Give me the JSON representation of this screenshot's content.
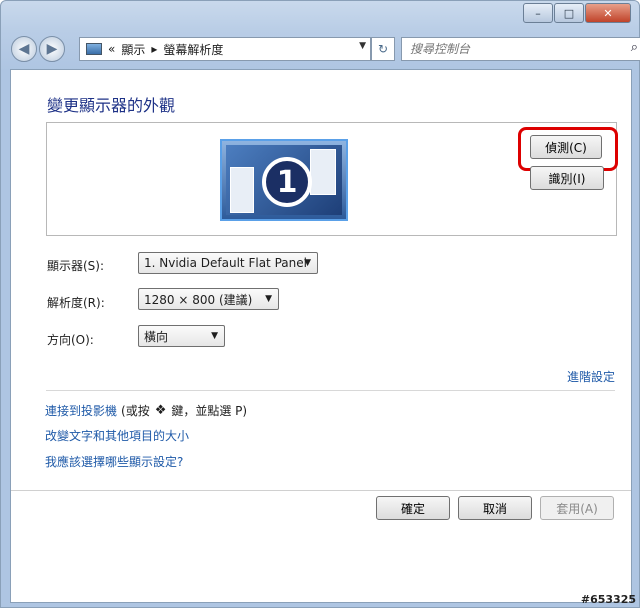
{
  "window": {
    "minimize": "–",
    "maximize": "□",
    "close": "✕"
  },
  "nav": {
    "back_icon": "back-arrow-icon",
    "forward_icon": "forward-arrow-icon",
    "breadcrumb_sep": "«",
    "crumb1": "顯示",
    "crumb_arrow": "▸",
    "crumb2": "螢幕解析度",
    "search_placeholder": "搜尋控制台"
  },
  "page": {
    "title": "變更顯示器的外觀"
  },
  "preview": {
    "monitor_number": "1",
    "detect_label": "偵測(C)",
    "identify_label": "識別(I)"
  },
  "settings": {
    "display_label": "顯示器(S):",
    "display_value": "1. Nvidia Default Flat Panel",
    "resolution_label": "解析度(R):",
    "resolution_value": "1280 × 800 (建議)",
    "orientation_label": "方向(O):",
    "orientation_value": "橫向",
    "advanced_link": "進階設定"
  },
  "links": {
    "projector_a": "連接到投影機",
    "projector_b": "(或按",
    "projector_c": "鍵，並點選 P)",
    "text_size": "改變文字和其他項目的大小",
    "which_settings": "我應該選擇哪些顯示設定?"
  },
  "footer": {
    "ok_label": "確定",
    "cancel_label": "取消",
    "apply_label": "套用(A)"
  },
  "watermark": "#653325",
  "colors": {
    "accent": "#1f5aa8",
    "highlight": "#dd0000",
    "title": "#1e3287"
  }
}
